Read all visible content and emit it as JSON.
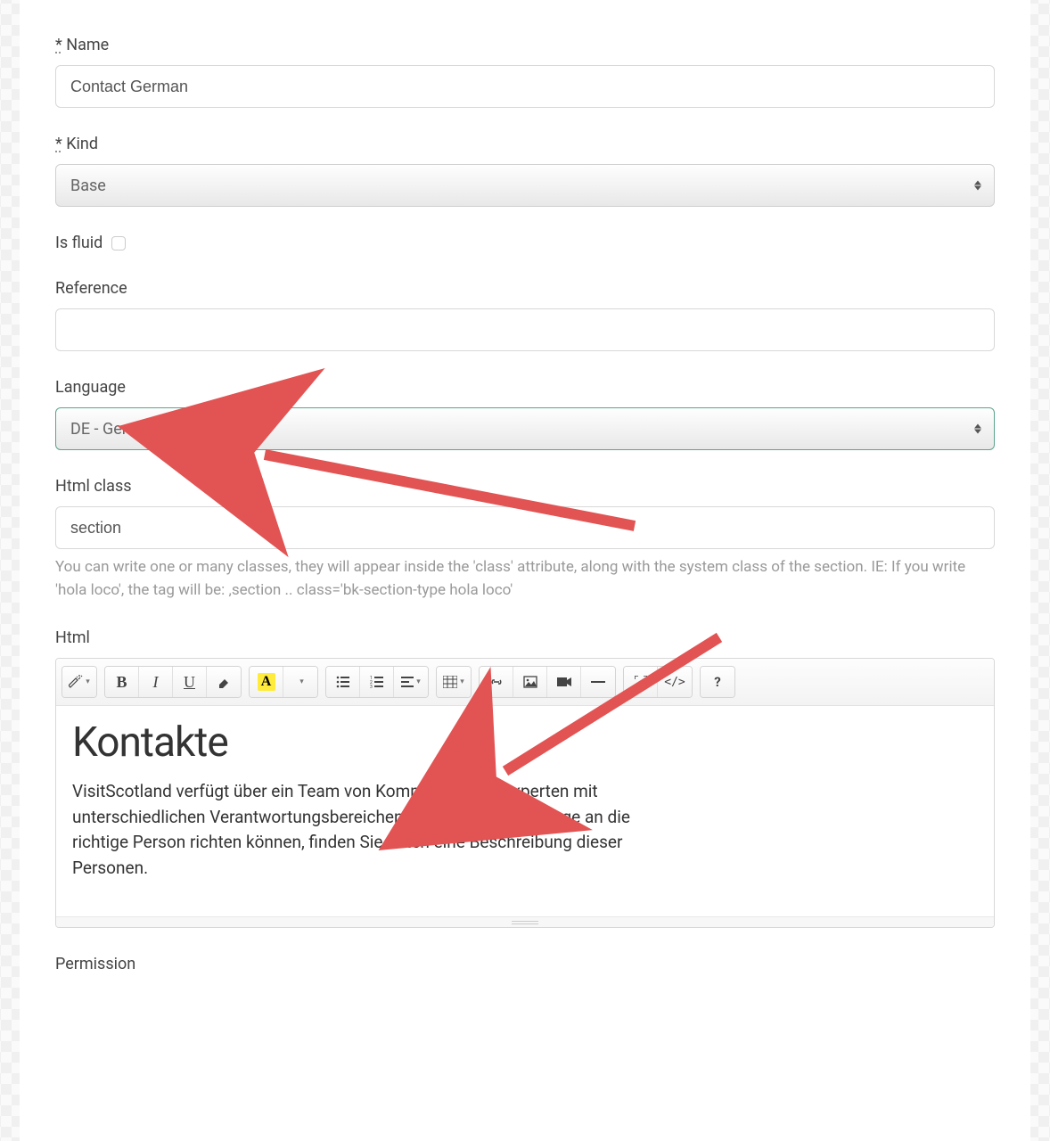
{
  "fields": {
    "name": {
      "label": "Name",
      "required_mark": "*",
      "value": "Contact German"
    },
    "kind": {
      "label": "Kind",
      "required_mark": "*",
      "value": "Base"
    },
    "is_fluid": {
      "label": "Is fluid",
      "checked": false
    },
    "reference": {
      "label": "Reference",
      "value": ""
    },
    "language": {
      "label": "Language",
      "value": "DE - German"
    },
    "html_class": {
      "label": "Html class",
      "value": "section",
      "help": "You can write one or many classes, they will appear inside the 'class' attribute, along with the system class of the section. IE: If you write 'hola loco', the tag will be: ‚section .. class='bk-section-type hola loco'"
    },
    "html": {
      "label": "Html",
      "heading": "Kontakte",
      "body": "VisitScotland verfügt über ein Team von Kommunikationsexperten mit unterschiedlichen Verantwortungsbereichen. Damit Sie Ihre Anfrage an die richtige Person richten können, finden Sie unten eine Beschreibung dieser Personen."
    },
    "permission": {
      "label": "Permission"
    }
  },
  "editor_toolbar": {
    "magic": "✨",
    "bold": "B",
    "italic": "I",
    "underline": "U",
    "eraser": "⌫",
    "font_color": "A",
    "ul": "≣",
    "ol": "≡",
    "align": "≡",
    "table": "▦",
    "link": "🔗",
    "image": "🖼",
    "video": "▰",
    "hr": "—",
    "fullscreen": "⤢",
    "code": "</>",
    "help": "?"
  }
}
